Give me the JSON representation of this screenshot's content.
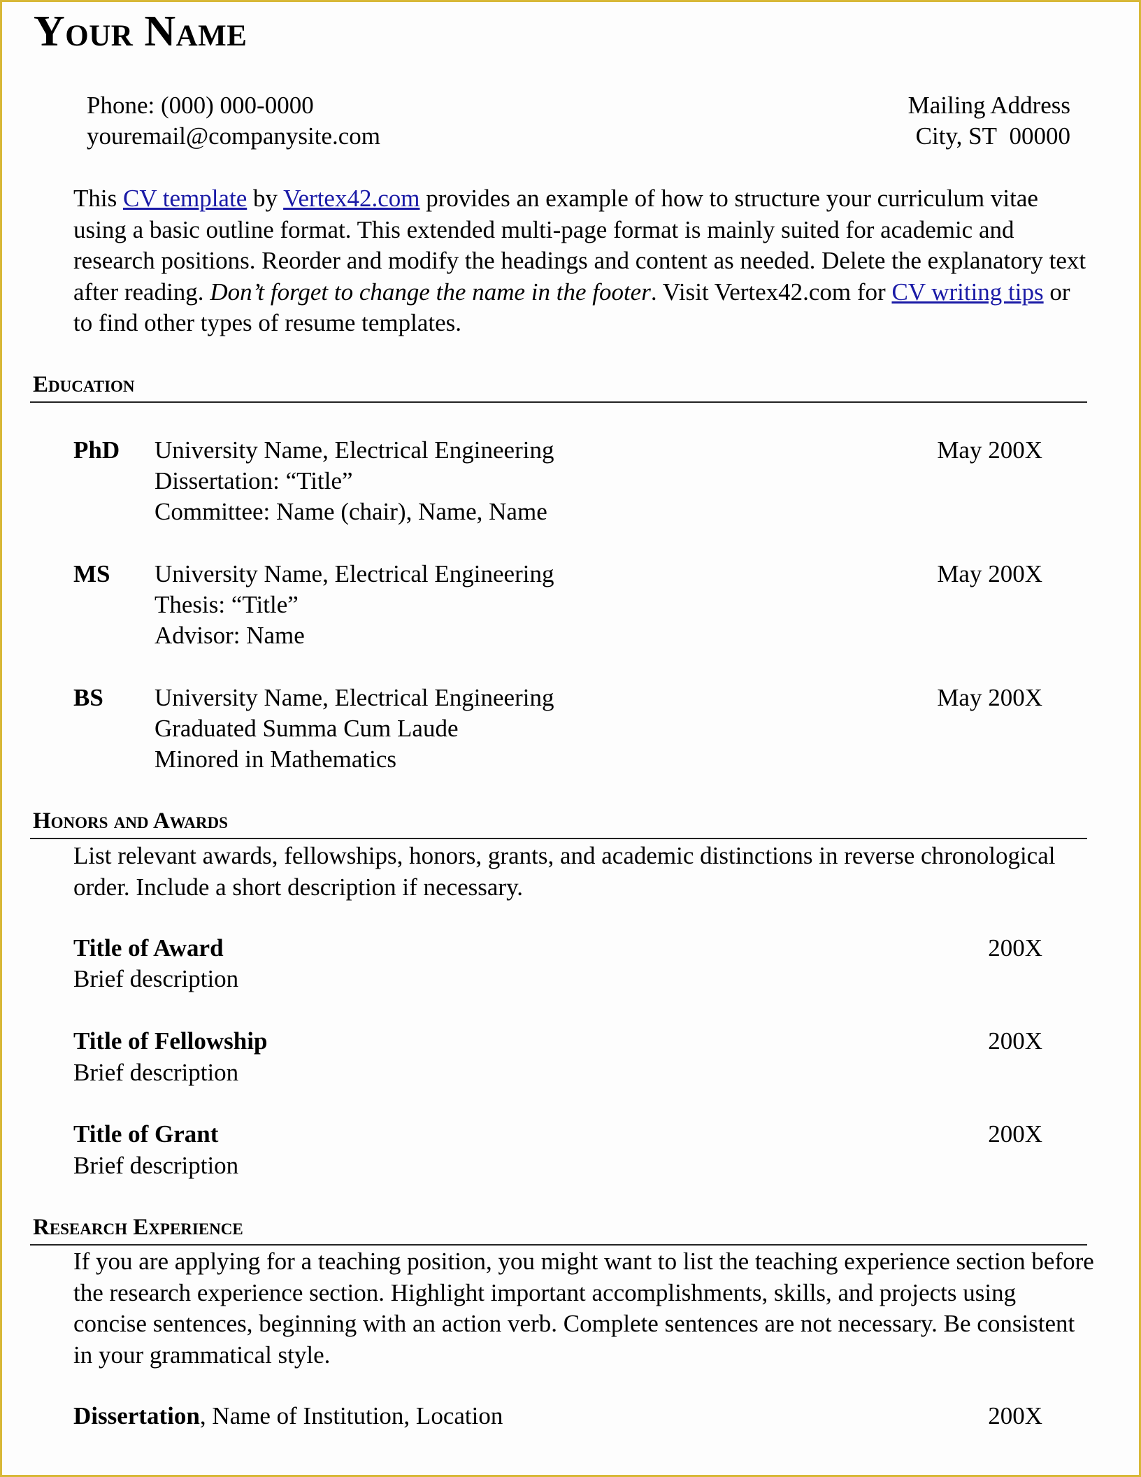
{
  "header": {
    "name": "Your Name",
    "phone": "Phone: (000) 000-0000",
    "email": "youremail@companysite.com",
    "address_line1": "Mailing Address",
    "address_line2": "City, ST  00000"
  },
  "intro": {
    "t1": "This ",
    "link1": "CV template",
    "t2": " by ",
    "link2": "Vertex42.com",
    "t3": " provides an example of how to structure your curriculum vitae using a basic outline format. This extended multi-page format is mainly suited for academic and research positions. Reorder and modify the headings and content as needed. Delete the explanatory text after reading. ",
    "italic": "Don’t forget to change the name in the footer",
    "t4": ". Visit Vertex42.com for ",
    "link3": "CV writing tips",
    "t5": " or to find other types of resume templates.",
    "link_color": "#1a1aa6"
  },
  "education": {
    "heading": "Education",
    "degrees": [
      {
        "label": "PhD",
        "lines": [
          "University Name, Electrical Engineering",
          "Dissertation: “Title”",
          "Committee: Name (chair), Name, Name"
        ],
        "date": "May 200X"
      },
      {
        "label": "MS",
        "lines": [
          "University Name, Electrical Engineering",
          "Thesis: “Title”",
          "Advisor: Name"
        ],
        "date": "May 200X"
      },
      {
        "label": "BS",
        "lines": [
          "University Name, Electrical Engineering",
          "Graduated Summa Cum Laude",
          "Minored in Mathematics"
        ],
        "date": "May 200X"
      }
    ]
  },
  "honors": {
    "heading": "Honors and Awards",
    "description": "List relevant awards, fellowships, honors, grants, and academic distinctions in reverse chronological order. Include a short description if necessary.",
    "items": [
      {
        "title": "Title of Award",
        "desc": "Brief description",
        "year": "200X"
      },
      {
        "title": "Title of Fellowship",
        "desc": "Brief description",
        "year": "200X"
      },
      {
        "title": "Title of Grant",
        "desc": "Brief description",
        "year": "200X"
      }
    ]
  },
  "research": {
    "heading": "Research Experience",
    "description": "If you are applying for a teaching position, you might want to list the teaching experience section before the research experience section. Highlight important accomplishments, skills, and projects using concise sentences, beginning with an action verb. Complete sentences are not necessary. Be consistent in your grammatical style.",
    "entry": {
      "title": "Dissertation",
      "rest": ", Name of Institution, Location",
      "year": "200X"
    }
  },
  "colors": {
    "frame": "#d8b838",
    "link": "#1a1aa6",
    "text": "#000000"
  }
}
